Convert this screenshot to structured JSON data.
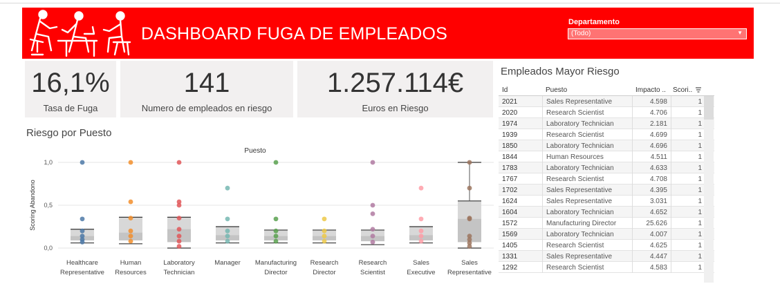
{
  "header": {
    "title": "DASHBOARD FUGA DE EMPLEADOS",
    "brand_color": "#ff0000",
    "filter": {
      "label": "Departamento",
      "selected": "(Todo)"
    }
  },
  "kpis": [
    {
      "value": "16,1%",
      "label": "Tasa de Fuga"
    },
    {
      "value": "141",
      "label": "Numero de empleados en riesgo"
    },
    {
      "value": "1.257.114€",
      "label": "Euros en Riesgo"
    }
  ],
  "chart": {
    "section_title": "Riesgo por Puesto",
    "chart_data": {
      "type": "scatter",
      "title": "Puesto",
      "xlabel": "",
      "ylabel": "Scoring Abandono",
      "ylim": [
        0,
        1
      ],
      "yticks": [
        "0,0",
        "0,5",
        "1,0"
      ],
      "grid": true,
      "categories": [
        [
          "Healthcare",
          "Representative"
        ],
        [
          "Human",
          "Resources"
        ],
        [
          "Laboratory",
          "Technician"
        ],
        [
          "Manager",
          ""
        ],
        [
          "Manufacturing",
          "Director"
        ],
        [
          "Research",
          "Director"
        ],
        [
          "Research",
          "Scientist"
        ],
        [
          "Sales",
          "Executive"
        ],
        [
          "Sales",
          "Representative"
        ]
      ],
      "series": [
        {
          "color": "#4e79a7",
          "points": [
            1.0,
            0.34,
            0.2,
            0.14,
            0.1,
            0.07
          ],
          "box": [
            0.06,
            0.09,
            0.14,
            0.22
          ]
        },
        {
          "color": "#f28e2b",
          "points": [
            1.0,
            0.54,
            0.35,
            0.2,
            0.14,
            0.08
          ],
          "box": [
            0.05,
            0.09,
            0.18,
            0.36
          ]
        },
        {
          "color": "#e15759",
          "points": [
            1.0,
            0.54,
            0.5,
            0.35,
            0.22,
            0.14,
            0.08,
            0.02
          ],
          "box": [
            0.0,
            0.07,
            0.22,
            0.36
          ]
        },
        {
          "color": "#76b7b2",
          "points": [
            0.7,
            0.34,
            0.2,
            0.14,
            0.08
          ],
          "box": [
            0.06,
            0.09,
            0.15,
            0.25
          ]
        },
        {
          "color": "#59a14f",
          "points": [
            1.0,
            0.34,
            0.2,
            0.14,
            0.08
          ],
          "box": [
            0.06,
            0.09,
            0.14,
            0.21
          ]
        },
        {
          "color": "#edc948",
          "points": [
            0.34,
            0.2,
            0.14,
            0.08
          ],
          "box": [
            0.06,
            0.09,
            0.14,
            0.21
          ]
        },
        {
          "color": "#b07aa1",
          "points": [
            1.0,
            0.5,
            0.4,
            0.22,
            0.14,
            0.07
          ],
          "box": [
            0.04,
            0.08,
            0.14,
            0.21
          ]
        },
        {
          "color": "#ff9da7",
          "points": [
            0.7,
            0.34,
            0.2,
            0.14,
            0.08
          ],
          "box": [
            0.06,
            0.09,
            0.15,
            0.25
          ]
        },
        {
          "color": "#9c755f",
          "points": [
            1.0,
            0.7,
            0.35,
            0.34,
            0.14,
            0.1,
            0.06,
            0.02
          ],
          "box": [
            0.0,
            0.07,
            0.34,
            0.55,
            1.0
          ]
        }
      ]
    }
  },
  "table": {
    "title": "Empleados Mayor Riesgo",
    "columns": [
      "Id",
      "Puesto",
      "Impacto ..",
      "Scori.."
    ],
    "sort_icon": "sort-descending-icon",
    "rows": [
      [
        "2021",
        "Sales Representative",
        "4.598",
        "1"
      ],
      [
        "2020",
        "Research Scientist",
        "4.706",
        "1"
      ],
      [
        "1974",
        "Laboratory Technician",
        "2.181",
        "1"
      ],
      [
        "1939",
        "Research Scientist",
        "4.699",
        "1"
      ],
      [
        "1850",
        "Laboratory Technician",
        "4.696",
        "1"
      ],
      [
        "1844",
        "Human Resources",
        "4.511",
        "1"
      ],
      [
        "1783",
        "Laboratory Technician",
        "4.633",
        "1"
      ],
      [
        "1767",
        "Research Scientist",
        "4.708",
        "1"
      ],
      [
        "1702",
        "Sales Representative",
        "4.395",
        "1"
      ],
      [
        "1624",
        "Sales Representative",
        "3.031",
        "1"
      ],
      [
        "1604",
        "Laboratory Technician",
        "4.652",
        "1"
      ],
      [
        "1572",
        "Manufacturing Director",
        "25.626",
        "1"
      ],
      [
        "1569",
        "Laboratory Technician",
        "4.007",
        "1"
      ],
      [
        "1405",
        "Research Scientist",
        "4.625",
        "1"
      ],
      [
        "1331",
        "Sales Representative",
        "4.447",
        "1"
      ],
      [
        "1292",
        "Research Scientist",
        "4.583",
        "1"
      ]
    ]
  }
}
